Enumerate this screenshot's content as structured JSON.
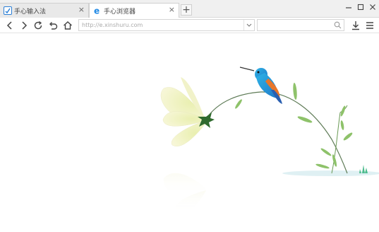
{
  "tabs": [
    {
      "label": "手心输入法",
      "icon": "input-method-icon",
      "active": false
    },
    {
      "label": "手心浏览器",
      "icon": "browser-e-icon",
      "active": true
    }
  ],
  "new_tab_label": "+",
  "address_bar": {
    "value": "http://e.xinshuru.com"
  },
  "window_controls": [
    "minimize-icon",
    "maximize-icon",
    "close-icon"
  ],
  "nav_icons": [
    "back-icon",
    "forward-icon",
    "reload-icon",
    "undo-icon",
    "home-icon"
  ],
  "toolbar_icons": [
    "download-icon",
    "menu-icon"
  ],
  "colors": {
    "accent": "#1e88e5",
    "tab_bar": "#f0f0f0"
  }
}
